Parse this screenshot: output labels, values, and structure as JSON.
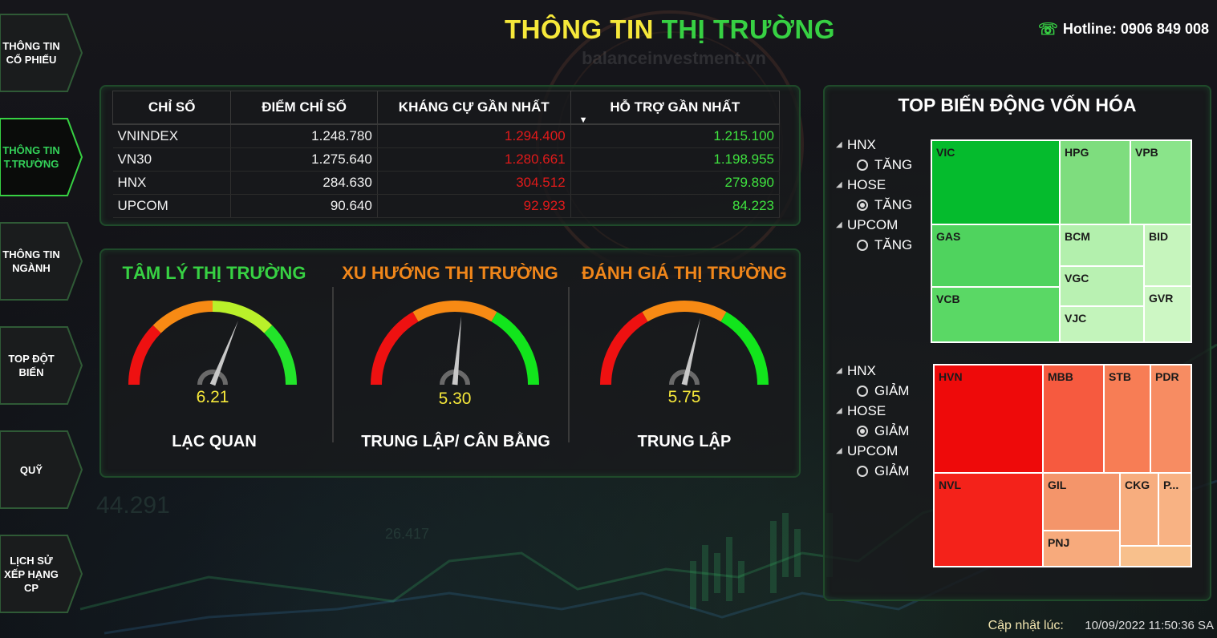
{
  "header": {
    "title_part1": "THÔNG TIN",
    "title_part2": "THỊ TRƯỜNG",
    "watermark": "balanceinvestment.vn",
    "hotline": "Hotline: 0906 849 008"
  },
  "sidebar": {
    "items": [
      {
        "label": "THÔNG TIN CỔ PHIẾU",
        "active": false
      },
      {
        "label": "THÔNG TIN T.TRƯỜNG",
        "active": true
      },
      {
        "label": "THÔNG TIN NGÀNH",
        "active": false
      },
      {
        "label": "TOP ĐỘT BIẾN",
        "active": false
      },
      {
        "label": "QUỸ",
        "active": false
      },
      {
        "label": "LỊCH SỬ XẾP HẠNG CP",
        "active": false
      }
    ]
  },
  "index_table": {
    "headers": [
      "CHỈ SỐ",
      "ĐIỂM CHỈ SỐ",
      "KHÁNG CỰ GẦN NHẤT",
      "HỖ TRỢ GẦN NHẤT"
    ],
    "rows": [
      {
        "name": "VNINDEX",
        "points": "1.248.780",
        "resistance": "1.294.400",
        "support": "1.215.100"
      },
      {
        "name": "VN30",
        "points": "1.275.640",
        "resistance": "1.280.661",
        "support": "1.198.955"
      },
      {
        "name": "HNX",
        "points": "284.630",
        "resistance": "304.512",
        "support": "279.890"
      },
      {
        "name": "UPCOM",
        "points": "90.640",
        "resistance": "92.923",
        "support": "84.223"
      }
    ]
  },
  "gauges": [
    {
      "title": "TÂM LÝ THỊ TRƯỜNG",
      "title_color": "#37d143",
      "value": "6.21",
      "score": 6.21,
      "label": "LẠC QUAN",
      "scheme": "four"
    },
    {
      "title": "XU HƯỚNG THỊ TRƯỜNG",
      "title_color": "#f0861a",
      "value": "5.30",
      "score": 5.3,
      "label": "TRUNG LẬP/ CÂN BẰNG",
      "scheme": "three"
    },
    {
      "title": "ĐÁNH GIÁ THỊ TRƯỜNG",
      "title_color": "#f0861a",
      "value": "5.75",
      "score": 5.75,
      "label": "TRUNG LẬP",
      "scheme": "three"
    }
  ],
  "treemap": {
    "title": "TOP BIẾN ĐỘNG VỐN HÓA",
    "up_filters": [
      {
        "exchange": "HNX",
        "option": "TĂNG",
        "selected": false
      },
      {
        "exchange": "HOSE",
        "option": "TĂNG",
        "selected": true
      },
      {
        "exchange": "UPCOM",
        "option": "TĂNG",
        "selected": false
      }
    ],
    "down_filters": [
      {
        "exchange": "HNX",
        "option": "GIẢM",
        "selected": false
      },
      {
        "exchange": "HOSE",
        "option": "GIẢM",
        "selected": true
      },
      {
        "exchange": "UPCOM",
        "option": "GIẢM",
        "selected": false
      }
    ],
    "gainers": [
      "VIC",
      "HPG",
      "VPB",
      "GAS",
      "BCM",
      "BID",
      "VGC",
      "VCB",
      "VJC",
      "GVR"
    ],
    "losers": [
      "HVN",
      "MBB",
      "STB",
      "PDR",
      "NVL",
      "GIL",
      "CKG",
      "P...",
      "PNJ",
      ""
    ],
    "colors": {
      "VIC": "#05bb2d",
      "HPG": "#7edd7e",
      "VPB": "#8ae48a",
      "GAS": "#4fd35e",
      "BCM": "#b3f0ad",
      "BID": "#c6f5bd",
      "VGC": "#b9f1b2",
      "VCB": "#5ad865",
      "VJC": "#c3f4bb",
      "GVR": "#cdf7c4",
      "HVN": "#ee0a0a",
      "MBB": "#f65a3f",
      "STB": "#f77d55",
      "PDR": "#f78c62",
      "NVL": "#f4221a",
      "GIL": "#f4956a",
      "CKG": "#f7ad7e",
      "P...": "#f8b283",
      "PNJ": "#f7aa7c",
      "": "#f8c08c"
    }
  },
  "footer": {
    "update_label": "Cập nhật lúc:",
    "update_time": "10/09/2022 11:50:36 SA"
  }
}
